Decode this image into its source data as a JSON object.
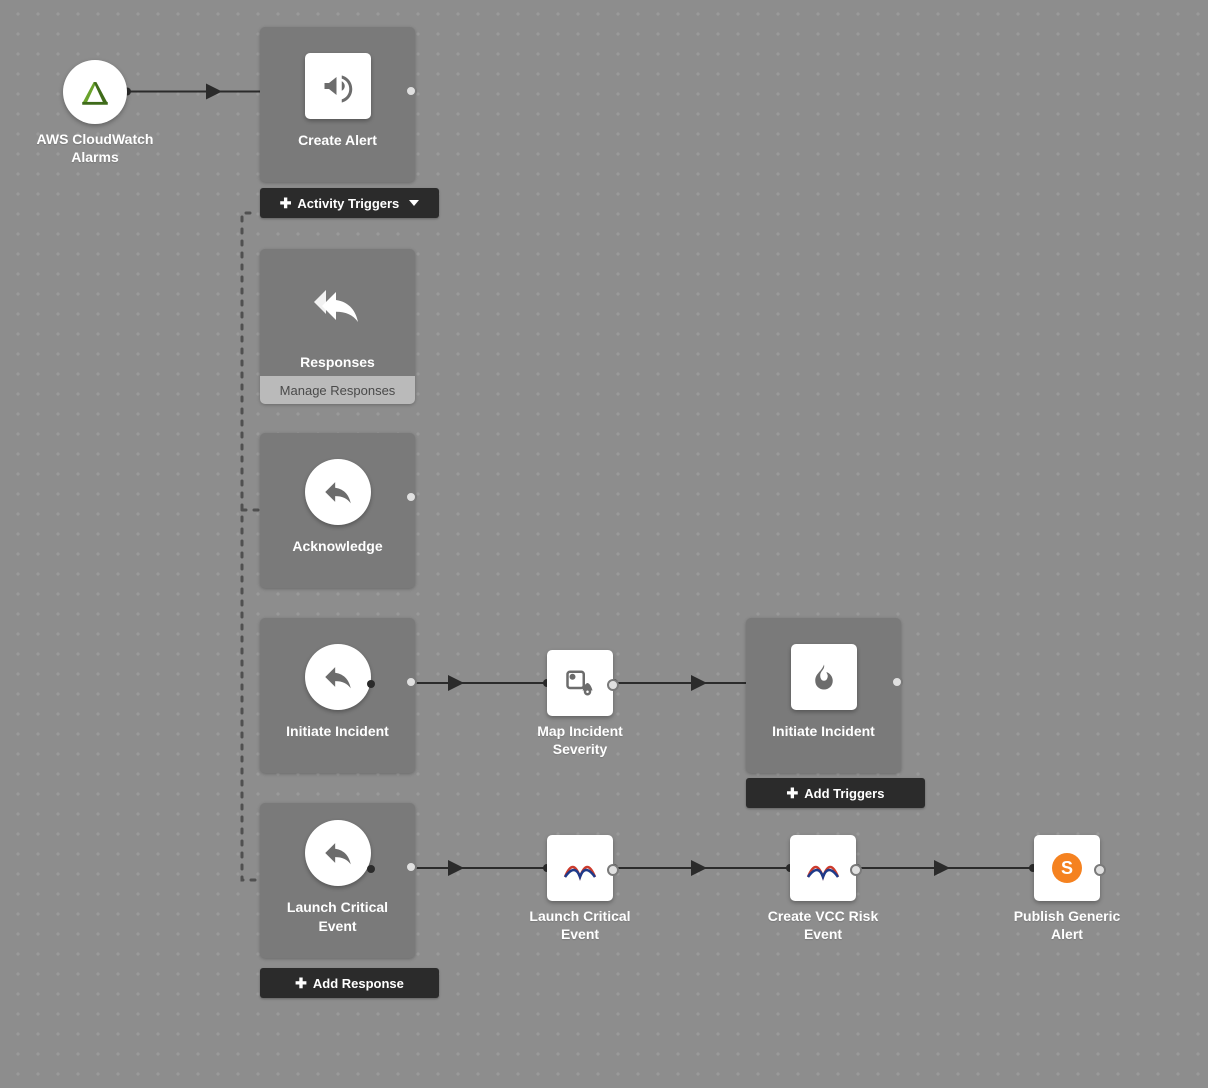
{
  "nodes": {
    "aws": {
      "label": "AWS CloudWatch Alarms"
    },
    "create_alert": {
      "label": "Create Alert"
    },
    "responses": {
      "title": "Responses",
      "sub": "Manage Responses"
    },
    "acknowledge": {
      "label": "Acknowledge"
    },
    "initiate_incident_1": {
      "label": "Initiate Incident"
    },
    "map_severity": {
      "label": "Map Incident Severity"
    },
    "initiate_incident_2": {
      "label": "Initiate Incident"
    },
    "launch_critical_1": {
      "label": "Launch Critical Event"
    },
    "launch_critical_2": {
      "label": "Launch Critical Event"
    },
    "create_vcc": {
      "label": "Create VCC Risk Event"
    },
    "publish_alert": {
      "label": "Publish Generic Alert"
    }
  },
  "buttons": {
    "activity_triggers": "Activity Triggers",
    "add_triggers": "Add Triggers",
    "add_response": "Add Response"
  }
}
